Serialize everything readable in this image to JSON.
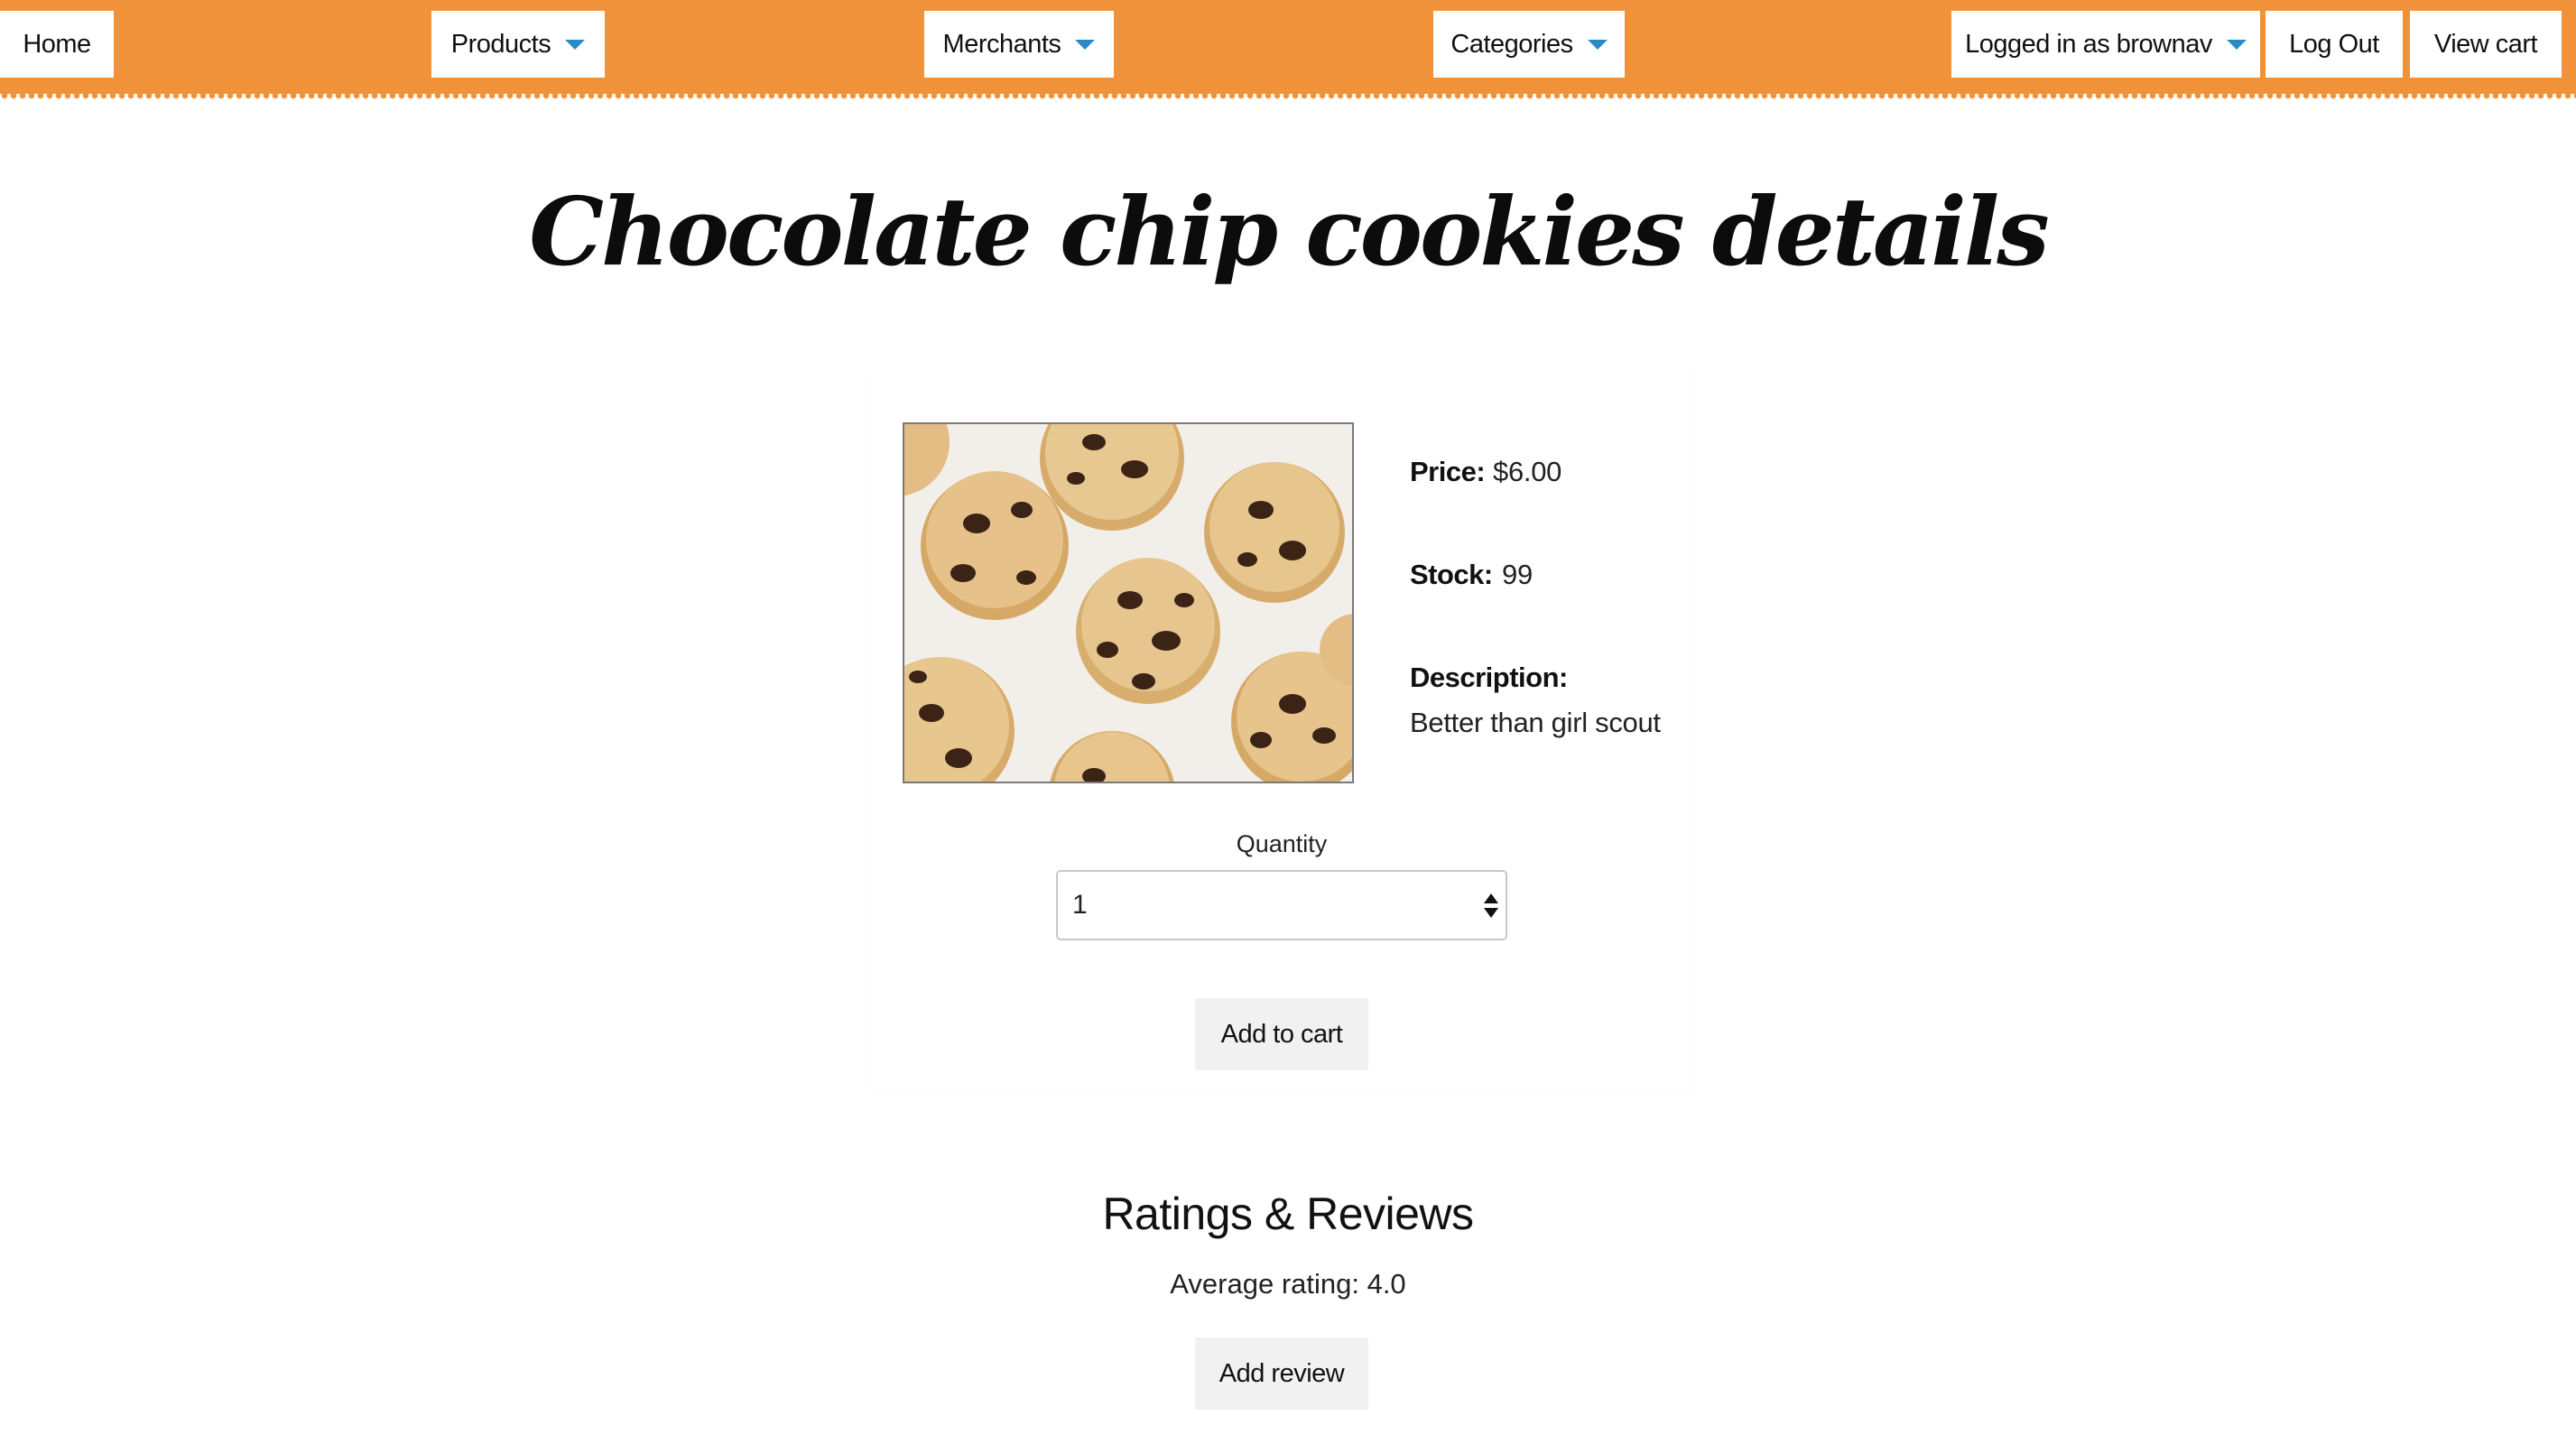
{
  "nav": {
    "home": "Home",
    "products": "Products",
    "merchants": "Merchants",
    "categories": "Categories",
    "user": "Logged in as brownav",
    "logout": "Log Out",
    "cart": "View cart"
  },
  "page": {
    "title": "Chocolate chip cookies details"
  },
  "product": {
    "price_label": "Price:",
    "price_value": "$6.00",
    "stock_label": "Stock:",
    "stock_value": "99",
    "description_label": "Description:",
    "description_value": "Better than girl scout",
    "quantity_label": "Quantity",
    "quantity_value": "1",
    "add_to_cart": "Add to cart"
  },
  "reviews": {
    "title": "Ratings & Reviews",
    "average": "Average rating: 4.0",
    "add_review": "Add review"
  },
  "colors": {
    "nav_bg": "#f0923a",
    "caret": "#2a8ac8",
    "button_bg": "#f1f1f1"
  }
}
